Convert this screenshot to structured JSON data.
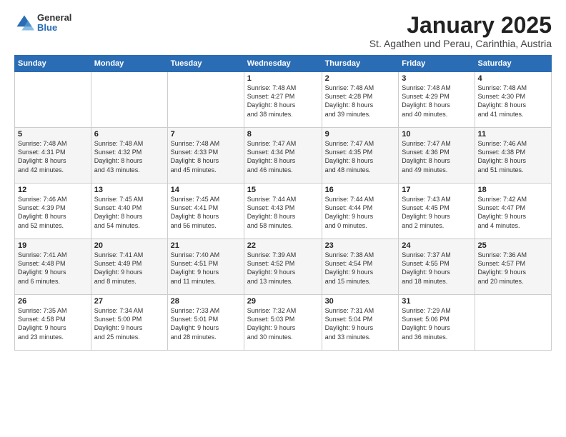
{
  "logo": {
    "general": "General",
    "blue": "Blue"
  },
  "title": "January 2025",
  "location": "St. Agathen und Perau, Carinthia, Austria",
  "weekdays": [
    "Sunday",
    "Monday",
    "Tuesday",
    "Wednesday",
    "Thursday",
    "Friday",
    "Saturday"
  ],
  "weeks": [
    [
      {
        "day": "",
        "content": ""
      },
      {
        "day": "",
        "content": ""
      },
      {
        "day": "",
        "content": ""
      },
      {
        "day": "1",
        "content": "Sunrise: 7:48 AM\nSunset: 4:27 PM\nDaylight: 8 hours\nand 38 minutes."
      },
      {
        "day": "2",
        "content": "Sunrise: 7:48 AM\nSunset: 4:28 PM\nDaylight: 8 hours\nand 39 minutes."
      },
      {
        "day": "3",
        "content": "Sunrise: 7:48 AM\nSunset: 4:29 PM\nDaylight: 8 hours\nand 40 minutes."
      },
      {
        "day": "4",
        "content": "Sunrise: 7:48 AM\nSunset: 4:30 PM\nDaylight: 8 hours\nand 41 minutes."
      }
    ],
    [
      {
        "day": "5",
        "content": "Sunrise: 7:48 AM\nSunset: 4:31 PM\nDaylight: 8 hours\nand 42 minutes."
      },
      {
        "day": "6",
        "content": "Sunrise: 7:48 AM\nSunset: 4:32 PM\nDaylight: 8 hours\nand 43 minutes."
      },
      {
        "day": "7",
        "content": "Sunrise: 7:48 AM\nSunset: 4:33 PM\nDaylight: 8 hours\nand 45 minutes."
      },
      {
        "day": "8",
        "content": "Sunrise: 7:47 AM\nSunset: 4:34 PM\nDaylight: 8 hours\nand 46 minutes."
      },
      {
        "day": "9",
        "content": "Sunrise: 7:47 AM\nSunset: 4:35 PM\nDaylight: 8 hours\nand 48 minutes."
      },
      {
        "day": "10",
        "content": "Sunrise: 7:47 AM\nSunset: 4:36 PM\nDaylight: 8 hours\nand 49 minutes."
      },
      {
        "day": "11",
        "content": "Sunrise: 7:46 AM\nSunset: 4:38 PM\nDaylight: 8 hours\nand 51 minutes."
      }
    ],
    [
      {
        "day": "12",
        "content": "Sunrise: 7:46 AM\nSunset: 4:39 PM\nDaylight: 8 hours\nand 52 minutes."
      },
      {
        "day": "13",
        "content": "Sunrise: 7:45 AM\nSunset: 4:40 PM\nDaylight: 8 hours\nand 54 minutes."
      },
      {
        "day": "14",
        "content": "Sunrise: 7:45 AM\nSunset: 4:41 PM\nDaylight: 8 hours\nand 56 minutes."
      },
      {
        "day": "15",
        "content": "Sunrise: 7:44 AM\nSunset: 4:43 PM\nDaylight: 8 hours\nand 58 minutes."
      },
      {
        "day": "16",
        "content": "Sunrise: 7:44 AM\nSunset: 4:44 PM\nDaylight: 9 hours\nand 0 minutes."
      },
      {
        "day": "17",
        "content": "Sunrise: 7:43 AM\nSunset: 4:45 PM\nDaylight: 9 hours\nand 2 minutes."
      },
      {
        "day": "18",
        "content": "Sunrise: 7:42 AM\nSunset: 4:47 PM\nDaylight: 9 hours\nand 4 minutes."
      }
    ],
    [
      {
        "day": "19",
        "content": "Sunrise: 7:41 AM\nSunset: 4:48 PM\nDaylight: 9 hours\nand 6 minutes."
      },
      {
        "day": "20",
        "content": "Sunrise: 7:41 AM\nSunset: 4:49 PM\nDaylight: 9 hours\nand 8 minutes."
      },
      {
        "day": "21",
        "content": "Sunrise: 7:40 AM\nSunset: 4:51 PM\nDaylight: 9 hours\nand 11 minutes."
      },
      {
        "day": "22",
        "content": "Sunrise: 7:39 AM\nSunset: 4:52 PM\nDaylight: 9 hours\nand 13 minutes."
      },
      {
        "day": "23",
        "content": "Sunrise: 7:38 AM\nSunset: 4:54 PM\nDaylight: 9 hours\nand 15 minutes."
      },
      {
        "day": "24",
        "content": "Sunrise: 7:37 AM\nSunset: 4:55 PM\nDaylight: 9 hours\nand 18 minutes."
      },
      {
        "day": "25",
        "content": "Sunrise: 7:36 AM\nSunset: 4:57 PM\nDaylight: 9 hours\nand 20 minutes."
      }
    ],
    [
      {
        "day": "26",
        "content": "Sunrise: 7:35 AM\nSunset: 4:58 PM\nDaylight: 9 hours\nand 23 minutes."
      },
      {
        "day": "27",
        "content": "Sunrise: 7:34 AM\nSunset: 5:00 PM\nDaylight: 9 hours\nand 25 minutes."
      },
      {
        "day": "28",
        "content": "Sunrise: 7:33 AM\nSunset: 5:01 PM\nDaylight: 9 hours\nand 28 minutes."
      },
      {
        "day": "29",
        "content": "Sunrise: 7:32 AM\nSunset: 5:03 PM\nDaylight: 9 hours\nand 30 minutes."
      },
      {
        "day": "30",
        "content": "Sunrise: 7:31 AM\nSunset: 5:04 PM\nDaylight: 9 hours\nand 33 minutes."
      },
      {
        "day": "31",
        "content": "Sunrise: 7:29 AM\nSunset: 5:06 PM\nDaylight: 9 hours\nand 36 minutes."
      },
      {
        "day": "",
        "content": ""
      }
    ]
  ]
}
